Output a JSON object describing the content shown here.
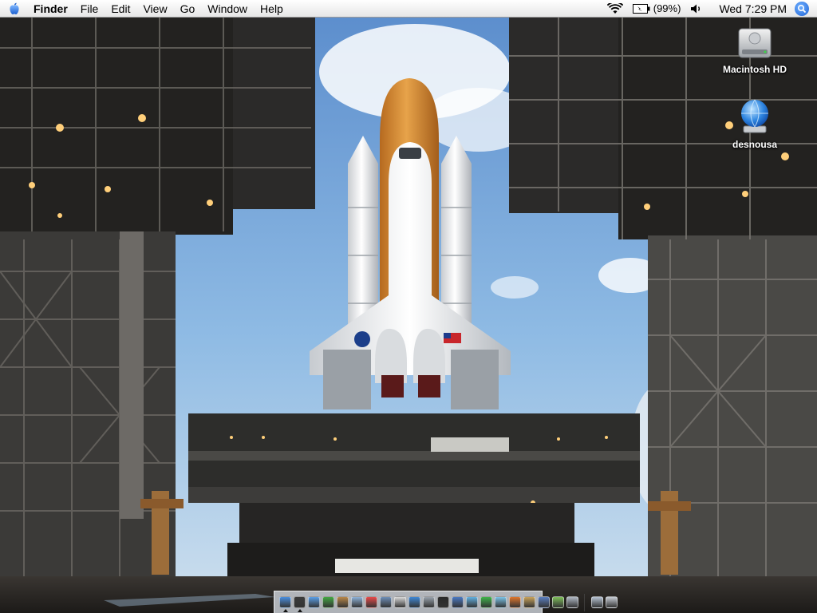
{
  "menubar": {
    "apple_icon": "apple-icon",
    "app_name": "Finder",
    "menus": [
      "File",
      "Edit",
      "View",
      "Go",
      "Window",
      "Help"
    ],
    "status": {
      "wifi_icon": "wifi-icon",
      "battery_icon": "battery-icon",
      "battery_text": "(99%)",
      "volume_icon": "volume-icon",
      "clock": "Wed 7:29 PM",
      "spotlight_icon": "spotlight-icon"
    }
  },
  "desktop": {
    "icons": [
      {
        "label": "Macintosh HD",
        "icon": "hard-drive-icon"
      },
      {
        "label": "desnousa",
        "icon": "network-globe-icon"
      }
    ]
  },
  "dock": {
    "apps": [
      {
        "icon": "finder-icon",
        "color": "#4a8fe0"
      },
      {
        "icon": "dashboard-icon",
        "color": "#3b3b3b"
      },
      {
        "icon": "safari-icon",
        "color": "#5aa0e8"
      },
      {
        "icon": "ichat-icon",
        "color": "#43a843"
      },
      {
        "icon": "address-book-icon",
        "color": "#b9884a"
      },
      {
        "icon": "mail-icon",
        "color": "#8fb2d8"
      },
      {
        "icon": "ical-icon",
        "color": "#e84a4a"
      },
      {
        "icon": "iphoto-icon",
        "color": "#6e8fb8"
      },
      {
        "icon": "preview-icon",
        "color": "#d9d9d9"
      },
      {
        "icon": "itunes-icon",
        "color": "#3f88d6"
      },
      {
        "icon": "system-preferences-icon",
        "color": "#9aa3ad"
      },
      {
        "icon": "terminal-icon",
        "color": "#2a2a2a"
      },
      {
        "icon": "xcode-icon",
        "color": "#4b79c2"
      },
      {
        "icon": "network-icon",
        "color": "#62b0e0"
      },
      {
        "icon": "messenger-icon",
        "color": "#3fb44a"
      },
      {
        "icon": "bookmark-icon",
        "color": "#7cc4e8"
      },
      {
        "icon": "firefox-icon",
        "color": "#e0762c"
      },
      {
        "icon": "photos-icon",
        "color": "#c9a35a"
      },
      {
        "icon": "folder-app-icon",
        "color": "#5a7fc0"
      },
      {
        "icon": "utility-icon",
        "color": "#7fbf5a"
      },
      {
        "icon": "settings-app-icon",
        "color": "#b0b8c4"
      }
    ],
    "stack": [
      {
        "icon": "documents-stack-icon",
        "color": "#b7c4d4"
      },
      {
        "icon": "trash-icon",
        "color": "#c8ced6"
      }
    ]
  }
}
